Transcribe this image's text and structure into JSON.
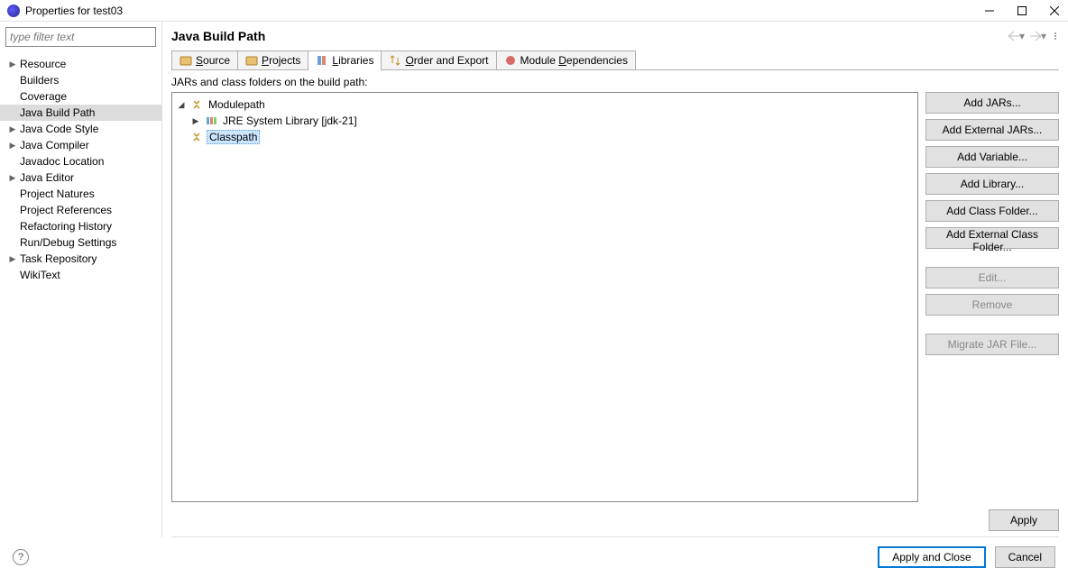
{
  "window": {
    "title": "Properties for test03",
    "filter_placeholder": "type filter text"
  },
  "sidebar": {
    "items": [
      {
        "label": "Resource",
        "expandable": true
      },
      {
        "label": "Builders",
        "expandable": false
      },
      {
        "label": "Coverage",
        "expandable": false
      },
      {
        "label": "Java Build Path",
        "expandable": false,
        "selected": true
      },
      {
        "label": "Java Code Style",
        "expandable": true
      },
      {
        "label": "Java Compiler",
        "expandable": true
      },
      {
        "label": "Javadoc Location",
        "expandable": false
      },
      {
        "label": "Java Editor",
        "expandable": true
      },
      {
        "label": "Project Natures",
        "expandable": false
      },
      {
        "label": "Project References",
        "expandable": false
      },
      {
        "label": "Refactoring History",
        "expandable": false
      },
      {
        "label": "Run/Debug Settings",
        "expandable": false
      },
      {
        "label": "Task Repository",
        "expandable": true
      },
      {
        "label": "WikiText",
        "expandable": false
      }
    ]
  },
  "page": {
    "title": "Java Build Path",
    "tabs": [
      {
        "label": "Source",
        "icon": "source"
      },
      {
        "label": "Projects",
        "icon": "projects"
      },
      {
        "label": "Libraries",
        "icon": "libraries",
        "active": true
      },
      {
        "label": "Order and Export",
        "icon": "order"
      },
      {
        "label": "Module Dependencies",
        "icon": "module"
      }
    ],
    "desc": "JARs and class folders on the build path:",
    "tree": {
      "modulepath": "Modulepath",
      "jre": "JRE System Library [jdk-21]",
      "classpath": "Classpath"
    }
  },
  "buttons": {
    "add_jars": "Add JARs...",
    "add_ext_jars": "Add External JARs...",
    "add_variable": "Add Variable...",
    "add_library": "Add Library...",
    "add_class_folder": "Add Class Folder...",
    "add_ext_class_folder": "Add External Class Folder...",
    "edit": "Edit...",
    "remove": "Remove",
    "migrate": "Migrate JAR File...",
    "apply": "Apply",
    "apply_close": "Apply and Close",
    "cancel": "Cancel"
  }
}
